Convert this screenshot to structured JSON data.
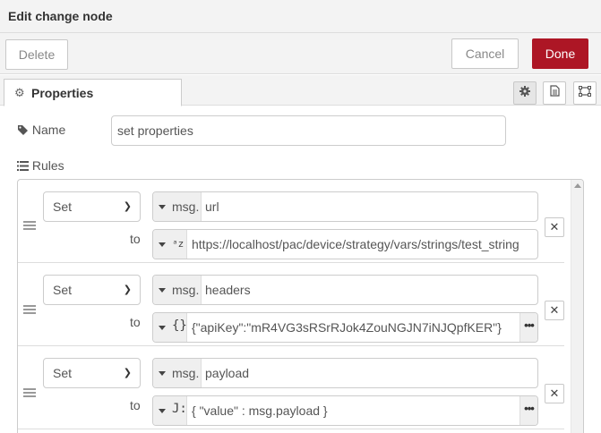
{
  "dialog": {
    "title": "Edit change node"
  },
  "toolbar": {
    "delete_label": "Delete",
    "cancel_label": "Cancel",
    "done_label": "Done"
  },
  "tabs": {
    "properties_label": "Properties",
    "properties_icon": "gear-icon"
  },
  "form": {
    "name_label": "Name",
    "name_value": "set properties",
    "rules_label": "Rules"
  },
  "rules": [
    {
      "action": "Set",
      "target_type": "msg.",
      "target_value": "url",
      "to_label": "to",
      "value_type_icon": "ᵃz",
      "value": "https://localhost/pac/device/strategy/vars/strings/test_string"
    },
    {
      "action": "Set",
      "target_type": "msg.",
      "target_value": "headers",
      "to_label": "to",
      "value_type_icon": "{}",
      "value": "{\"apiKey\":\"mR4VG3sRSrRJok4ZouNGJN7iNJQpfKER\"}"
    },
    {
      "action": "Set",
      "target_type": "msg.",
      "target_value": "payload",
      "to_label": "to",
      "value_type_icon": "J:",
      "value": "{ \"value\" : msg.payload }"
    }
  ],
  "colors": {
    "done_button": "#ad1625",
    "panel_bg": "#f3f3f3"
  }
}
